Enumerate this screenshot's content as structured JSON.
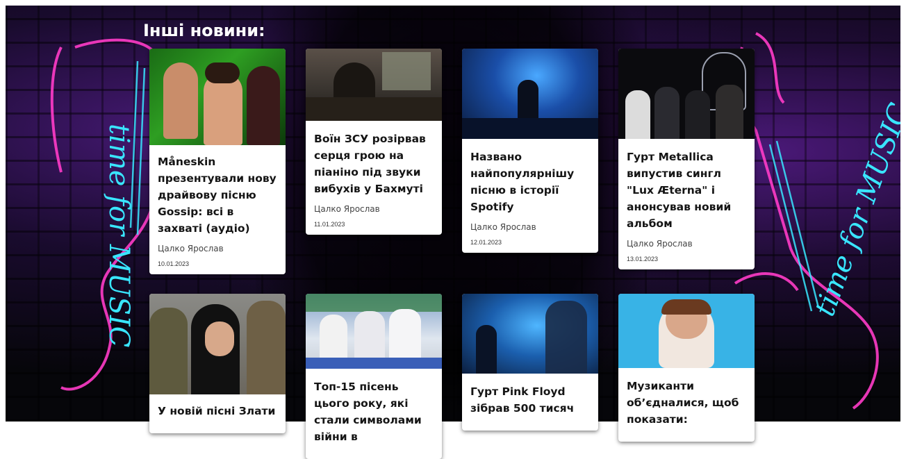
{
  "section_title": "Інші новини:",
  "articles": [
    {
      "title": "Måneskin презентували нову драйвову пісню Gossip: всі в захваті (аудіо)",
      "author": "Цалко Ярослав",
      "date": "10.01.2023"
    },
    {
      "title": "Воїн ЗСУ розірвав серця грою на піаніно під звуки вибухів у Бахмуті",
      "author": "Цалко Ярослав",
      "date": "11.01.2023"
    },
    {
      "title": "Названо найпопулярнішу пісню в історії Spotify",
      "author": "Цалко Ярослав",
      "date": "12.01.2023"
    },
    {
      "title": "Гурт Metallica випустив сингл \"Lux Æterna\" і анонсував новий альбом",
      "author": "Цалко Ярослав",
      "date": "13.01.2023"
    },
    {
      "title": "У новій пісні Злати",
      "author": "",
      "date": ""
    },
    {
      "title": "Топ-15 пісень цього року, які стали символами війни в",
      "author": "",
      "date": ""
    },
    {
      "title": "Гурт Pink Floyd зібрав 500 тисяч",
      "author": "",
      "date": ""
    },
    {
      "title": "Музиканти об’єдналися, щоб показати:",
      "author": "",
      "date": ""
    }
  ],
  "background": {
    "neon_text_left": "time for MUSIC",
    "neon_text_right": "time for MUSIC",
    "neon_pink": "#ff3cc8",
    "neon_cyan": "#39e6ff"
  }
}
